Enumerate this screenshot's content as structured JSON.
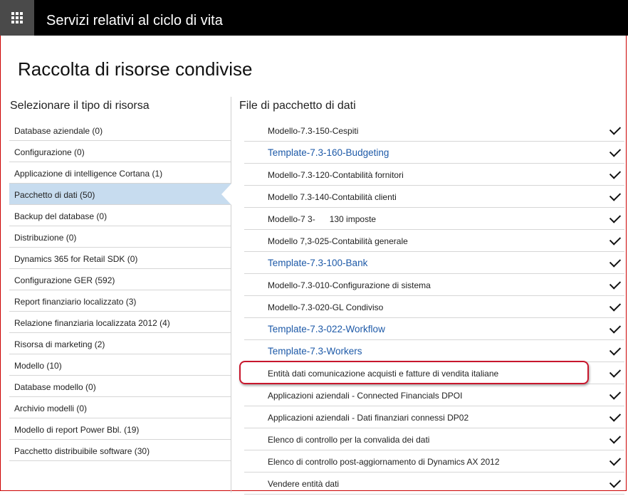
{
  "header": {
    "app_title": "Servizi relativi al ciclo di vita"
  },
  "page": {
    "title": "Raccolta di risorse condivise"
  },
  "left": {
    "heading": "Selezionare il tipo di risorsa",
    "items": [
      {
        "label": "Database aziendale (0)"
      },
      {
        "label": "Configurazione (0)"
      },
      {
        "label": "Applicazione di intelligence Cortana (1)"
      },
      {
        "label": "Pacchetto di dati (50)",
        "selected": true
      },
      {
        "label": "Backup del database (0)"
      },
      {
        "label": "Distribuzione (0)"
      },
      {
        "label": "Dynamics 365 for Retail SDK (0)"
      },
      {
        "label": "Configurazione GER (592)"
      },
      {
        "label": "Report finanziario localizzato (3)"
      },
      {
        "label": "Relazione finanziaria localizzata 2012 (4)"
      },
      {
        "label": "Risorsa di marketing (2)"
      },
      {
        "label": "Modello (10)"
      },
      {
        "label": "Database modello (0)"
      },
      {
        "label": "Archivio modelli (0)"
      },
      {
        "label": "Modello di report Power Bbl. (19)"
      },
      {
        "label": "Pacchetto distribuibile software (30)"
      }
    ]
  },
  "right": {
    "heading": "File di pacchetto di dati",
    "items": [
      {
        "label": "Modello-7.3-150-Cespiti",
        "link": false
      },
      {
        "label": "Template-7.3-160-Budgeting",
        "link": true
      },
      {
        "label": "Modello-7.3-120-Contabilità fornitori",
        "link": false
      },
      {
        "label": "Modello 7.3-140-Contabilità clienti",
        "link": false
      },
      {
        "label": "Modello-7 3-      130 imposte",
        "link": false
      },
      {
        "label": "Modello 7,3-025-Contabilità generale",
        "link": false
      },
      {
        "label": "Template-7.3-100-Bank",
        "link": true
      },
      {
        "label": "Modello-7.3-010-Configurazione di sistema",
        "link": false
      },
      {
        "label": "Modello-7.3-020-GL Condiviso",
        "link": false
      },
      {
        "label": "Template-7.3-022-Workflow",
        "link": true
      },
      {
        "label": "Template-7.3-Workers",
        "link": true
      },
      {
        "label": "Entità dati comunicazione acquisti e fatture di vendita italiane",
        "link": false,
        "highlighted": true
      },
      {
        "label": "Applicazioni aziendali - Connected Financials DPOI",
        "link": false
      },
      {
        "label": "Applicazioni aziendali - Dati finanziari connessi DP02",
        "link": false
      },
      {
        "label": "Elenco di controllo per la convalida dei dati",
        "link": false
      },
      {
        "label": "Elenco di controllo post-aggiornamento di Dynamics AX 2012",
        "link": false
      },
      {
        "label": "Vendere entità dati",
        "link": false
      }
    ]
  },
  "colors": {
    "accent_link": "#1e5aa8",
    "selected_bg": "#c7dcef",
    "highlight_border": "#c8162c",
    "topbar": "#000000"
  }
}
